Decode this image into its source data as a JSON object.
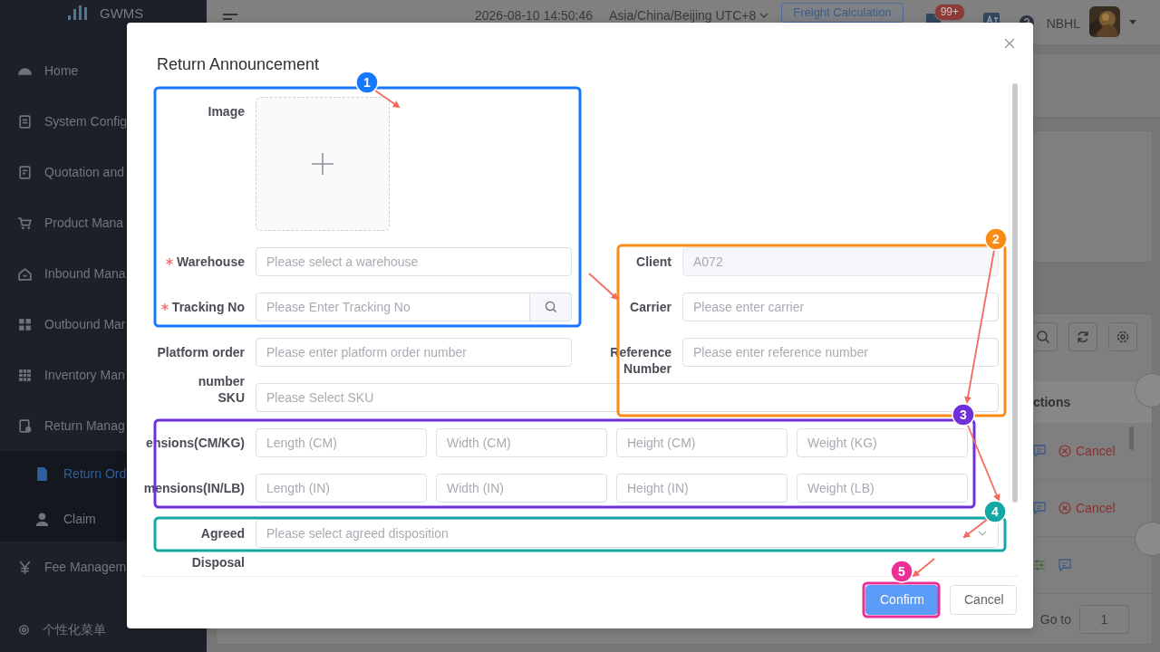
{
  "sidebar": {
    "logo": "GWMS",
    "items": [
      {
        "label": "Home"
      },
      {
        "label": "System Config"
      },
      {
        "label": "Quotation and"
      },
      {
        "label": "Product Mana"
      },
      {
        "label": "Inbound Mana"
      },
      {
        "label": "Outbound Mar"
      },
      {
        "label": "Inventory Man"
      },
      {
        "label": "Return Manag",
        "children": [
          {
            "label": "Return Ord",
            "selected": true
          },
          {
            "label": "Claim",
            "selected": false
          }
        ]
      },
      {
        "label": "Fee Managem"
      }
    ],
    "footer": "个性化菜单"
  },
  "header": {
    "datetime": "2026-08-10 14:50:46",
    "timezone": "Asia/China/Beijing UTC+8",
    "freight_button": "Freight Calculation",
    "notification_badge": "99+",
    "user": "NBHL"
  },
  "page": {
    "actions_header": "ctions",
    "rows": [
      {
        "kind": "cancel",
        "action": "Cancel"
      },
      {
        "kind": "cancel",
        "action": "Cancel"
      },
      {
        "kind": "adjust"
      }
    ],
    "goto_label": "Go to",
    "goto_value": "1"
  },
  "dialog": {
    "title": "Return Announcement",
    "rows": [
      {
        "kind": "upload",
        "label": [
          "Image"
        ]
      },
      {
        "kind": "pair",
        "left": {
          "label": [
            "Warehouse"
          ],
          "required": true,
          "placeholder": "Please select a warehouse"
        },
        "right": {
          "label": [
            "Client"
          ],
          "required": false,
          "disabled": true,
          "value": "A072"
        }
      },
      {
        "kind": "pair",
        "left": {
          "label": [
            "Tracking No"
          ],
          "required": true,
          "search": true,
          "placeholder": "Please Enter Tracking No"
        },
        "right": {
          "label": [
            "Carrier"
          ],
          "required": false,
          "placeholder": "Please enter carrier"
        }
      },
      {
        "kind": "pair",
        "left": {
          "label": [
            "Platform order",
            "number"
          ],
          "required": false,
          "placeholder": "Please enter platform order number"
        },
        "right": {
          "label": [
            "Reference",
            "Number"
          ],
          "required": false,
          "placeholder": "Please enter reference number"
        }
      },
      {
        "kind": "wide",
        "label": [
          "SKU"
        ],
        "placeholder": "Please Select SKU"
      },
      {
        "kind": "quad",
        "label": [
          "ensions(CM/KG)"
        ],
        "placeholders": [
          "Length (CM)",
          "Width (CM)",
          "Height (CM)",
          "Weight (KG)"
        ]
      },
      {
        "kind": "quad",
        "label": [
          "mensions(IN/LB)"
        ],
        "placeholders": [
          "Length (IN)",
          "Width (IN)",
          "Height (IN)",
          "Weight (LB)"
        ]
      },
      {
        "kind": "select",
        "label": [
          "Agreed",
          "Disposal"
        ],
        "placeholder": "Please select agreed disposition"
      }
    ],
    "buttons": [
      {
        "label": "Confirm",
        "kind": "primary"
      },
      {
        "label": "Cancel",
        "kind": "default"
      }
    ],
    "annotations": [
      {
        "number": "1",
        "color": "#1677ff"
      },
      {
        "number": "2",
        "color": "#fa8c16"
      },
      {
        "number": "3",
        "color": "#6f2fd9"
      },
      {
        "number": "4",
        "color": "#14a8a4"
      },
      {
        "number": "5",
        "color": "#eb2f96"
      }
    ]
  }
}
